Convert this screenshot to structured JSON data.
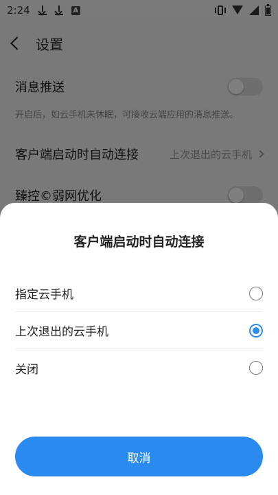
{
  "statusbar": {
    "time": "2:24",
    "a_label": "A"
  },
  "screen": {
    "title": "设置",
    "rows": [
      {
        "label": "消息推送",
        "type": "toggle",
        "on": false
      },
      {
        "hint": "开启后，如云手机未休眠，可接收云端应用的消息推送。"
      },
      {
        "label": "客户端启动时自动连接",
        "value": "上次退出的云手机"
      },
      {
        "label": "臻控©弱网优化",
        "type": "toggle",
        "on": false
      }
    ]
  },
  "sheet": {
    "title": "客户端启动时自动连接",
    "options": [
      {
        "label": "指定云手机",
        "selected": false
      },
      {
        "label": "上次退出的云手机",
        "selected": true
      },
      {
        "label": "关闭",
        "selected": false
      }
    ],
    "cancel_label": "取消"
  },
  "colors": {
    "accent": "#2b8af0",
    "overlay": "rgba(0,0,0,0.5)"
  }
}
